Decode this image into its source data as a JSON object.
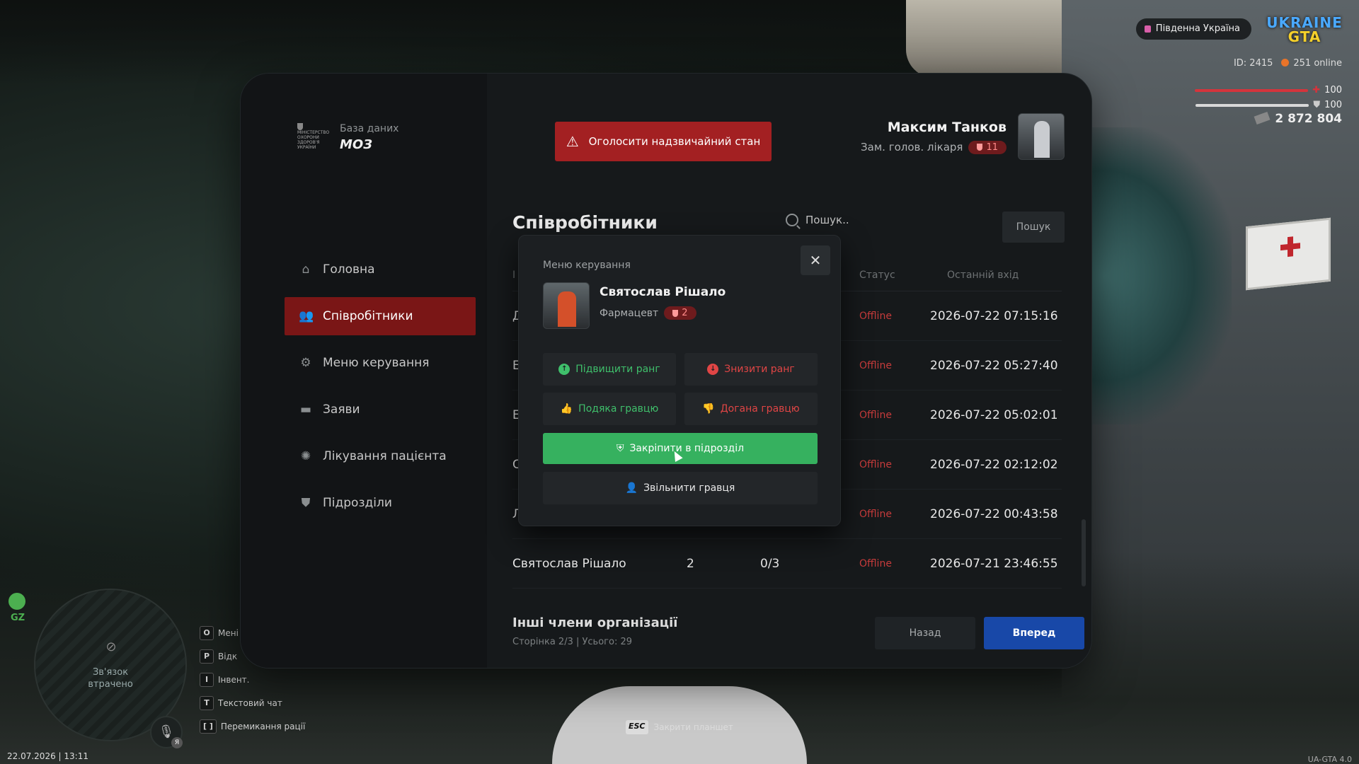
{
  "hud": {
    "server": "Південна Україна",
    "logo_top": "UKRAINE",
    "logo_bottom": "GTA",
    "id_text": "ID: 2415",
    "online_text": "251 online",
    "health": "100",
    "armor": "100",
    "money": "2 872 804",
    "health_color": "#d4343c",
    "armor_color": "#d8d8d8",
    "zone": "GZ",
    "connection_line1": "Зв'язок",
    "connection_line2": "втрачено",
    "mic_badge": "Я",
    "keys": [
      {
        "key": "O",
        "label": "Мені"
      },
      {
        "key": "P",
        "label": "Відк"
      },
      {
        "key": "I",
        "label": "Інвент."
      },
      {
        "key": "T",
        "label": "Текстовий чат"
      },
      {
        "key": "[ ]",
        "label": "Перемикання рації"
      }
    ],
    "esc_key": "ESC",
    "esc_label": "Закрити планшет",
    "datetime": "22.07.2026 | 13:11",
    "version": "UA-GTA 4.0"
  },
  "sidebar": {
    "emblem_text": "МІНІСТЕРСТВО ОХОРОНИ ЗДОРОВ'Я УКРАЇНИ",
    "brand_sub": "База даних",
    "brand_title": "МОЗ",
    "items": [
      {
        "label": "Головна",
        "icon": "home-icon",
        "glyph": "⌂"
      },
      {
        "label": "Співробітники",
        "icon": "users-icon",
        "glyph": "👥"
      },
      {
        "label": "Меню керування",
        "icon": "gear-icon",
        "glyph": "⚙"
      },
      {
        "label": "Заяви",
        "icon": "folder-icon",
        "glyph": "▬"
      },
      {
        "label": "Лікування пацієнта",
        "icon": "virus-icon",
        "glyph": "✺"
      },
      {
        "label": "Підрозділи",
        "icon": "shield-icon",
        "glyph": "⛊"
      }
    ],
    "active_index": 1
  },
  "header": {
    "alert_button": "Оголосити надзвичайний стан",
    "user_name": "Максим Танков",
    "user_role": "Зам. голов. лікаря",
    "user_rank": "11"
  },
  "main": {
    "title": "Співробітники",
    "search_placeholder": "Пошук..",
    "search_button": "Пошук",
    "columns": {
      "name": "І",
      "status": "Статус",
      "last_login": "Останній вхід"
    },
    "rows": [
      {
        "name": "Д",
        "rank": "",
        "warns": "",
        "status": "Offline",
        "last": "2026-07-22 07:15:16"
      },
      {
        "name": "Е",
        "rank": "",
        "warns": "",
        "status": "Offline",
        "last": "2026-07-22 05:27:40"
      },
      {
        "name": "Е",
        "rank": "",
        "warns": "",
        "status": "Offline",
        "last": "2026-07-22 05:02:01"
      },
      {
        "name": "С",
        "rank": "",
        "warns": "",
        "status": "Offline",
        "last": "2026-07-22 02:12:02"
      },
      {
        "name": "Л",
        "rank": "",
        "warns": "",
        "status": "Offline",
        "last": "2026-07-22 00:43:58"
      },
      {
        "name": "Святослав Рішало",
        "rank": "2",
        "warns": "0/3",
        "status": "Offline",
        "last": "2026-07-21 23:46:55"
      }
    ],
    "footer_title": "Інші члени організації",
    "footer_sub": "Сторінка 2/3 | Усього: 29",
    "back_button": "Назад",
    "next_button": "Вперед"
  },
  "modal": {
    "title": "Меню керування",
    "close_glyph": "✕",
    "name": "Святослав Рішало",
    "role": "Фармацевт",
    "rank": "2",
    "promote": "Підвищити ранг",
    "demote": "Знизити ранг",
    "thanks": "Подяка гравцю",
    "reprimand": "Догана гравцю",
    "assign": "Закріпити в підрозділ",
    "fire": "Звільнити гравця"
  }
}
